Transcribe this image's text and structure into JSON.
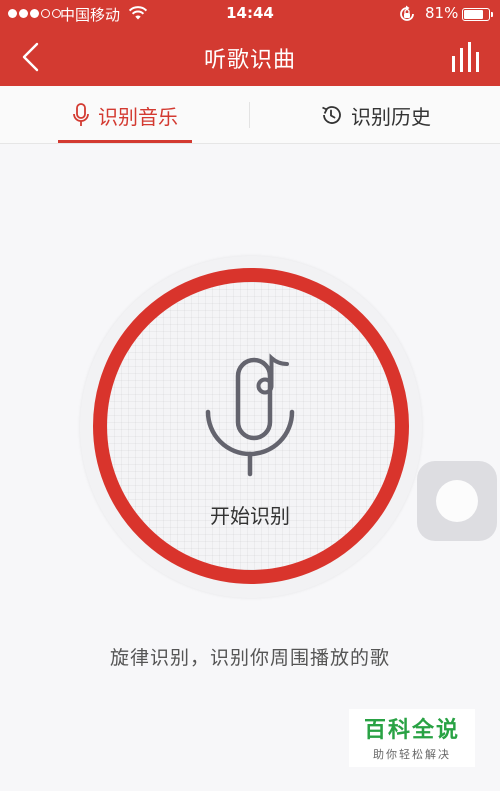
{
  "status_bar": {
    "carrier": "中国移动",
    "time": "14:44",
    "battery_percent": "81%",
    "battery_level": 0.81,
    "signal_bars_filled": 3,
    "signal_bars_total": 5
  },
  "nav": {
    "title": "听歌识曲",
    "back_icon": "chevron-left-icon",
    "right_icon": "equalizer-bars-icon"
  },
  "tabs": [
    {
      "label": "识别音乐",
      "icon": "microphone-icon",
      "active": true
    },
    {
      "label": "识别历史",
      "icon": "history-clock-icon",
      "active": false
    }
  ],
  "recognize": {
    "label": "开始识别",
    "icon": "microphone-music-note-icon"
  },
  "description": "旋律识别，识别你周围播放的歌",
  "watermark": {
    "title": "百科全说",
    "subtitle": "助你轻松解决"
  },
  "colors": {
    "brand_red": "#d33a31",
    "active_tab": "#d33a31",
    "watermark_green": "#29a244"
  }
}
